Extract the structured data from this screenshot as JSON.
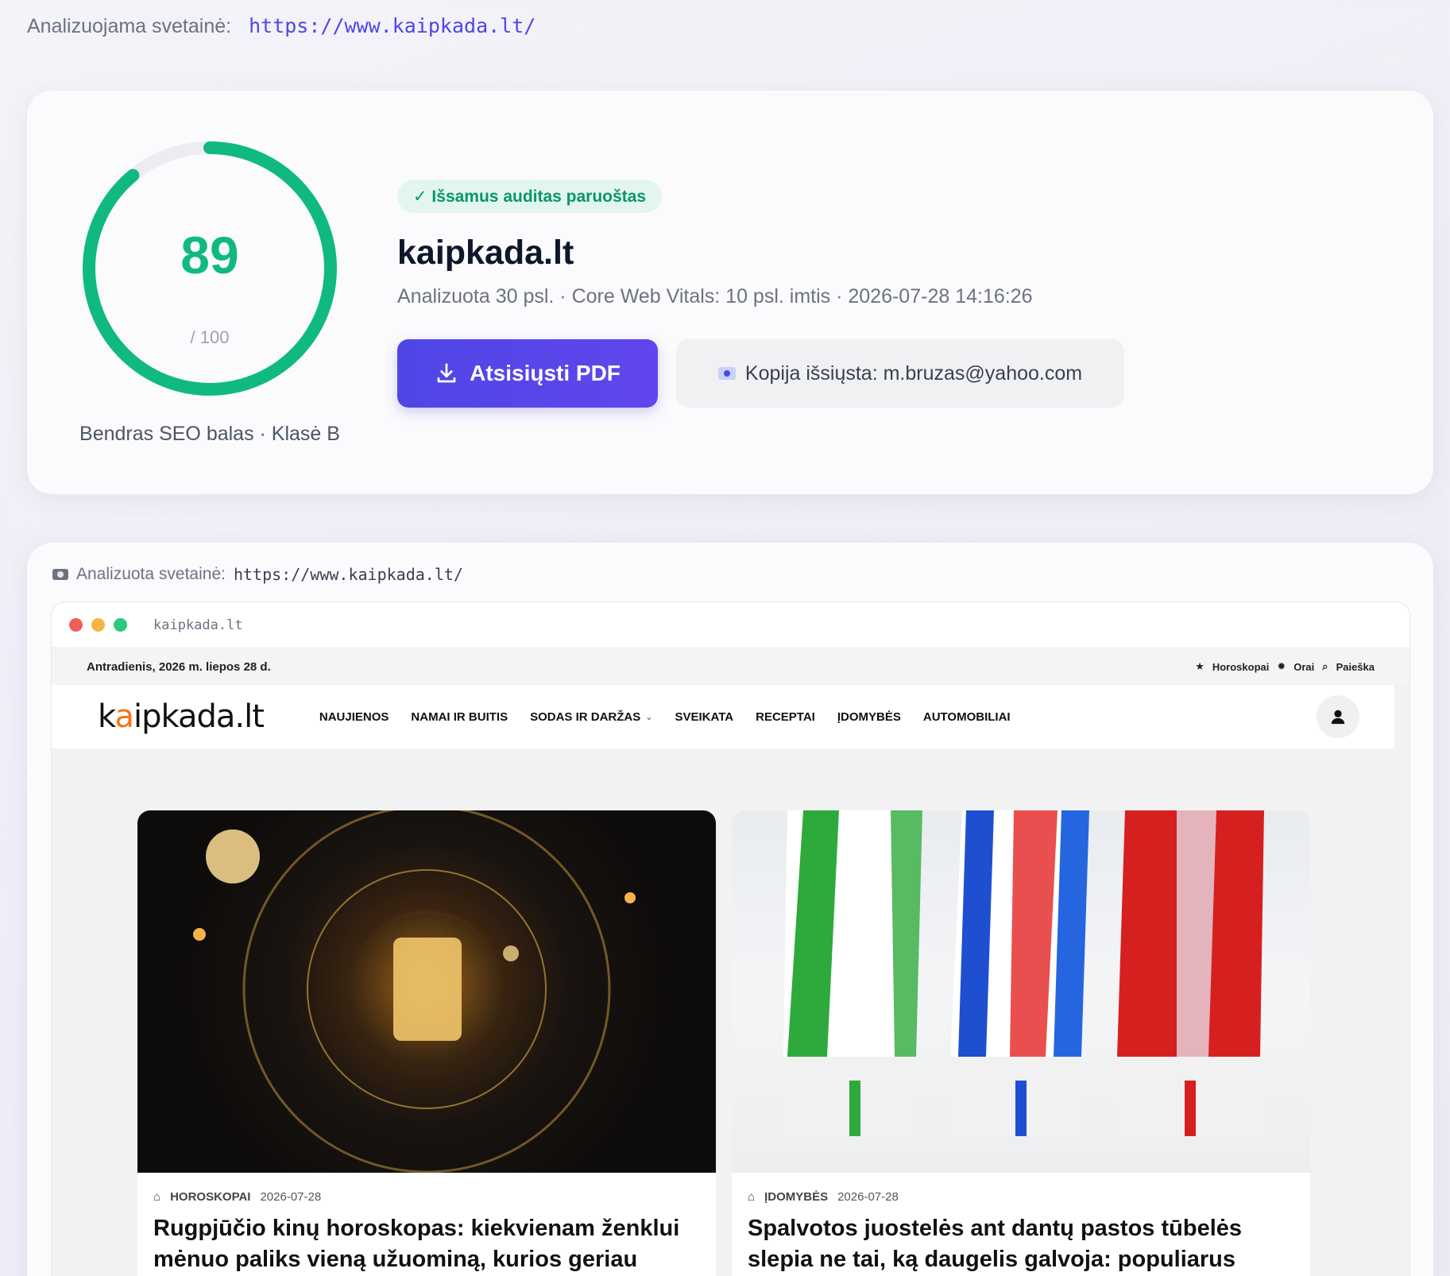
{
  "header": {
    "label": "Analizuojama svetainė:",
    "url": "https://www.kaipkada.lt/"
  },
  "score": {
    "value": "89",
    "max": "/ 100",
    "fraction": 0.89,
    "caption": "Bendras SEO balas · Klasė B",
    "color": "#10b981"
  },
  "summary": {
    "badge": "✓ Išsamus auditas paruoštas",
    "title": "kaipkada.lt",
    "meta": "Analizuota 30 psl. · Core Web Vitals: 10 psl. imtis · 2026-07-28 14:16:26",
    "pdf_button": "Atsisiųsti PDF",
    "copy_sent": "Kopija išsiųsta: m.bruzas@yahoo.com",
    "accent": "#4f46e5"
  },
  "screenshot": {
    "label": "Analizuota svetainė:",
    "url": "https://www.kaipkada.lt/",
    "address_bar": "kaipkada.lt",
    "site": {
      "date": "Antradienis, 2026 m. liepos 28 d.",
      "top_links": [
        "Horoskopai",
        "Orai",
        "Paieška"
      ],
      "logo": "kaipkada.lt",
      "menu": [
        "NAUJIENOS",
        "NAMAI IR BUITIS",
        "SODAS IR DARŽAS",
        "SVEIKATA",
        "RECEPTAI",
        "ĮDOMYBĖS",
        "AUTOMOBILIAI"
      ],
      "articles": [
        {
          "category": "HOROSKOPAI",
          "date": "2026-07-28",
          "title": "Rugpjūčio kinų horoskopas: kiekvienam ženklui mėnuo paliks vieną užuominą, kurios geriau"
        },
        {
          "category": "ĮDOMYBĖS",
          "date": "2026-07-28",
          "title": "Spalvotos juostelės ant dantų pastos tūbelės slepia ne tai, ką daugelis galvoja: populiarus mitas"
        }
      ]
    }
  }
}
